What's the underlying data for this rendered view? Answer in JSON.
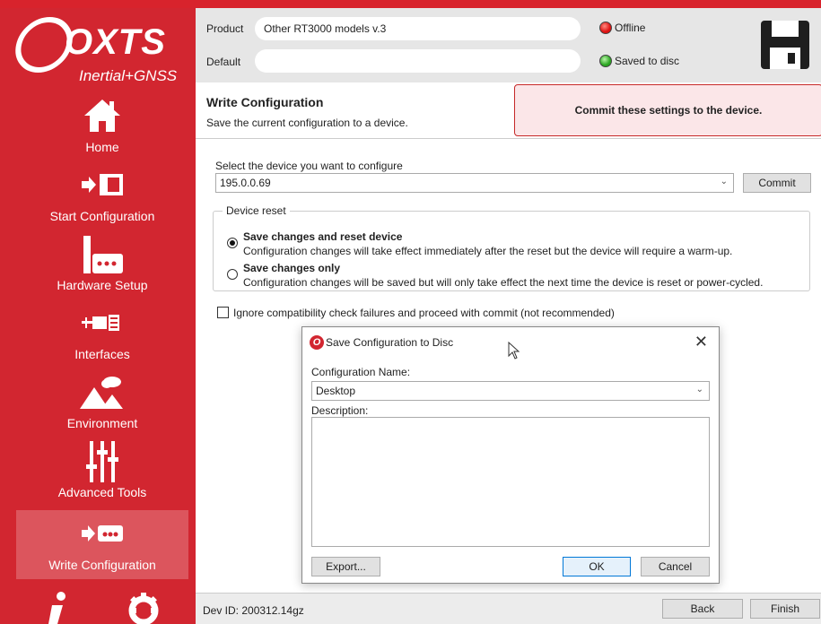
{
  "sidebar": {
    "logo": {
      "brand": "OXTS",
      "tagline": "Inertial+GNSS"
    },
    "items": [
      {
        "label": "Home",
        "icon": "home-icon"
      },
      {
        "label": "Start Configuration",
        "icon": "start-config-icon"
      },
      {
        "label": "Hardware Setup",
        "icon": "hardware-icon"
      },
      {
        "label": "Interfaces",
        "icon": "interfaces-icon"
      },
      {
        "label": "Environment",
        "icon": "environment-icon"
      },
      {
        "label": "Advanced Tools",
        "icon": "sliders-icon"
      },
      {
        "label": "Write Configuration",
        "icon": "write-config-icon",
        "active": true
      }
    ],
    "bottom_icons": [
      "info-icon",
      "gear-icon"
    ]
  },
  "topbar": {
    "product_label": "Product",
    "product_value": "Other RT3000 models v.3",
    "default_label": "Default",
    "default_value": "",
    "status_offline": "Offline",
    "status_saved": "Saved to disc",
    "save_icon": "floppy-disk-icon"
  },
  "header": {
    "title": "Write Configuration",
    "subtitle": "Save the current configuration to a device.",
    "callout": "Commit these settings to the device."
  },
  "device": {
    "select_label": "Select the device you want to configure",
    "selected": "195.0.0.69",
    "commit_label": "Commit"
  },
  "reset_group": {
    "legend": "Device reset",
    "options": [
      {
        "title": "Save changes and reset device",
        "desc": "Configuration changes will take effect immediately after the reset but the device will require a warm-up.",
        "selected": true
      },
      {
        "title": "Save changes only",
        "desc": "Configuration changes will be saved but will only take effect the next time the device is reset or power-cycled.",
        "selected": false
      }
    ]
  },
  "ignore_check": {
    "label": "Ignore compatibility check failures and proceed with commit (not recommended)",
    "checked": false
  },
  "footer": {
    "dev_id": "Dev ID: 200312.14gz",
    "back_label": "Back",
    "finish_label": "Finish"
  },
  "dialog": {
    "title": "Save Configuration to Disc",
    "name_label": "Configuration Name:",
    "name_value": "Desktop",
    "desc_label": "Description:",
    "desc_value": "",
    "export_label": "Export...",
    "ok_label": "OK",
    "cancel_label": "Cancel"
  },
  "colors": {
    "brand_red": "#d22630",
    "callout_bg": "#fbe6e8"
  }
}
